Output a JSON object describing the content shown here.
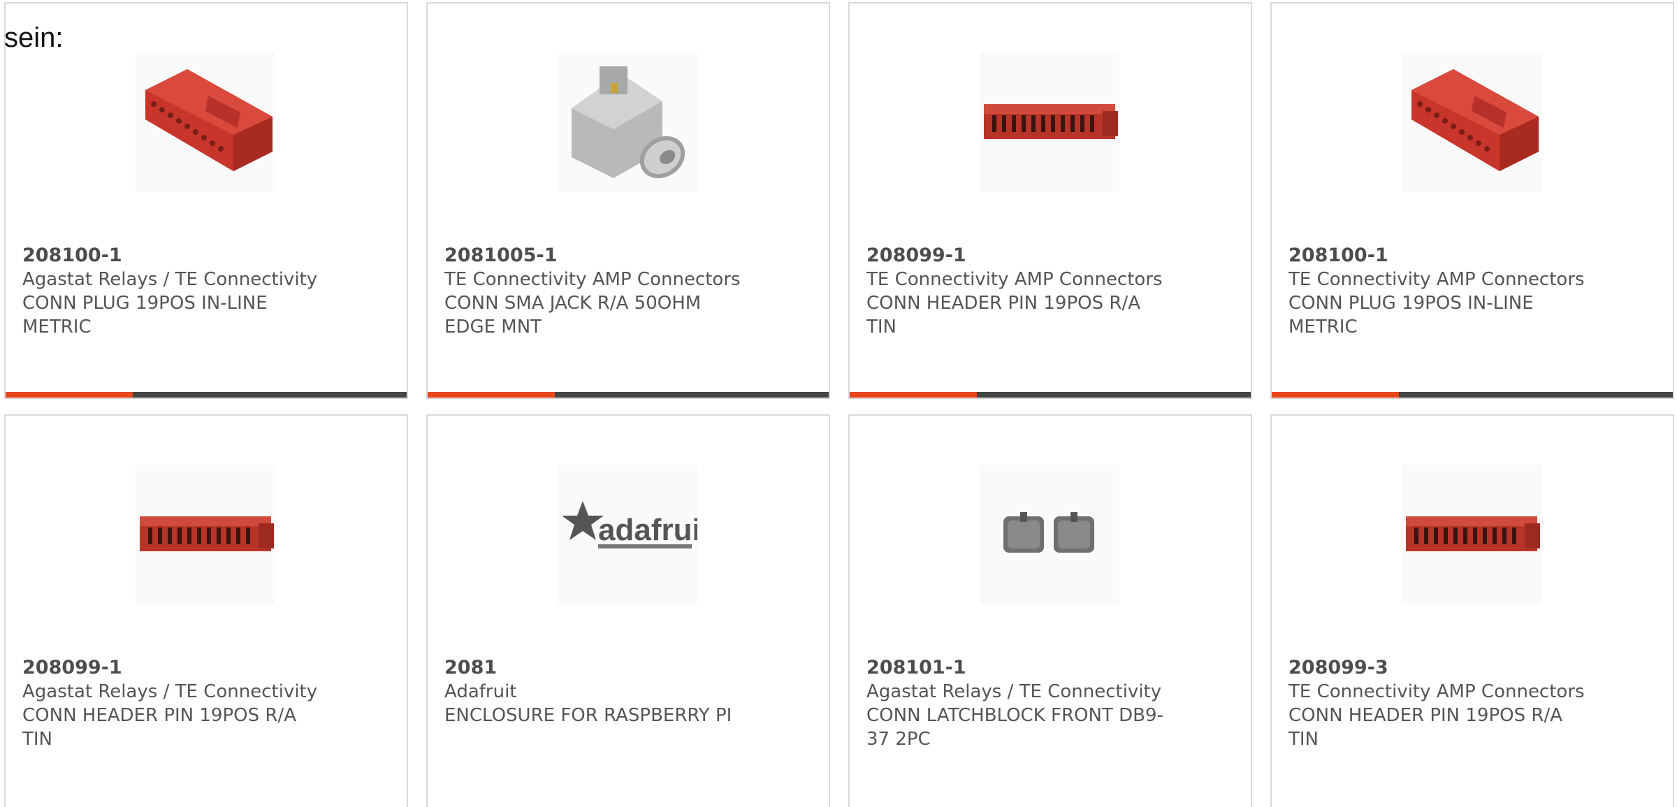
{
  "heading": "sein:",
  "accent_color": "#e8461d",
  "bar_color": "#454545",
  "products": [
    {
      "part": "208100-1",
      "manufacturer": "Agastat Relays / TE Connectivity",
      "description": "CONN PLUG 19POS IN-LINE METRIC",
      "image": "red-plug-connector"
    },
    {
      "part": "2081005-1",
      "manufacturer": "TE Connectivity AMP Connectors",
      "description": "CONN SMA JACK R/A 50OHM EDGE MNT",
      "image": "sma-jack-connector"
    },
    {
      "part": "208099-1",
      "manufacturer": "TE Connectivity AMP Connectors",
      "description": "CONN HEADER PIN 19POS R/A TIN",
      "image": "red-header-connector"
    },
    {
      "part": "208100-1",
      "manufacturer": "TE Connectivity AMP Connectors",
      "description": "CONN PLUG 19POS IN-LINE METRIC",
      "image": "red-plug-connector"
    },
    {
      "part": "208099-1",
      "manufacturer": "Agastat Relays / TE Connectivity",
      "description": "CONN HEADER PIN 19POS R/A TIN",
      "image": "red-header-connector"
    },
    {
      "part": "2081",
      "manufacturer": "Adafruit",
      "description": "ENCLOSURE FOR RASPBERRY PI",
      "image": "adafruit-logo",
      "logo_text": "adafruit"
    },
    {
      "part": "208101-1",
      "manufacturer": "Agastat Relays / TE Connectivity",
      "description": "CONN LATCHBLOCK FRONT DB9-37 2PC",
      "image": "latchblock-pair"
    },
    {
      "part": "208099-3",
      "manufacturer": "TE Connectivity AMP Connectors",
      "description": "CONN HEADER PIN 19POS R/A TIN",
      "image": "red-header-connector"
    }
  ]
}
